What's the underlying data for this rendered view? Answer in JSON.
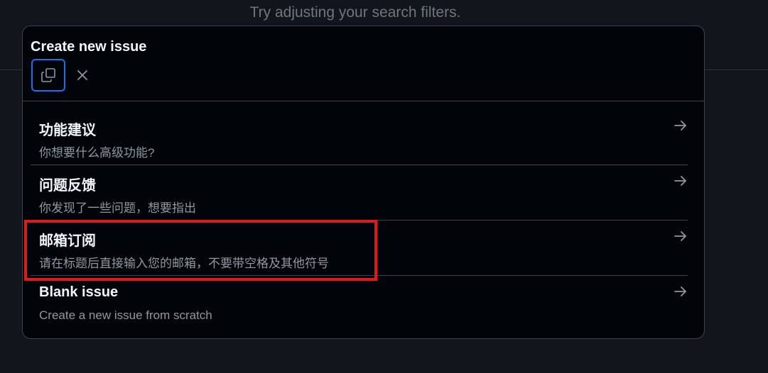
{
  "background": {
    "hint": "Try adjusting your search filters."
  },
  "dialog": {
    "title": "Create new issue",
    "options": [
      {
        "title": "功能建议",
        "description": "你想要什么高级功能?"
      },
      {
        "title": "问题反馈",
        "description": "你发现了一些问题，想要指出"
      },
      {
        "title": "邮箱订阅",
        "description": "请在标题后直接输入您的邮箱，不要带空格及其他符号"
      },
      {
        "title": "Blank issue",
        "description": "Create a new issue from scratch"
      }
    ]
  },
  "colors": {
    "accent": "#1f6feb",
    "highlight": "#e01a1a"
  },
  "icons": {
    "copy": "copy-icon",
    "close": "close-icon",
    "arrow": "arrow-right-icon"
  }
}
